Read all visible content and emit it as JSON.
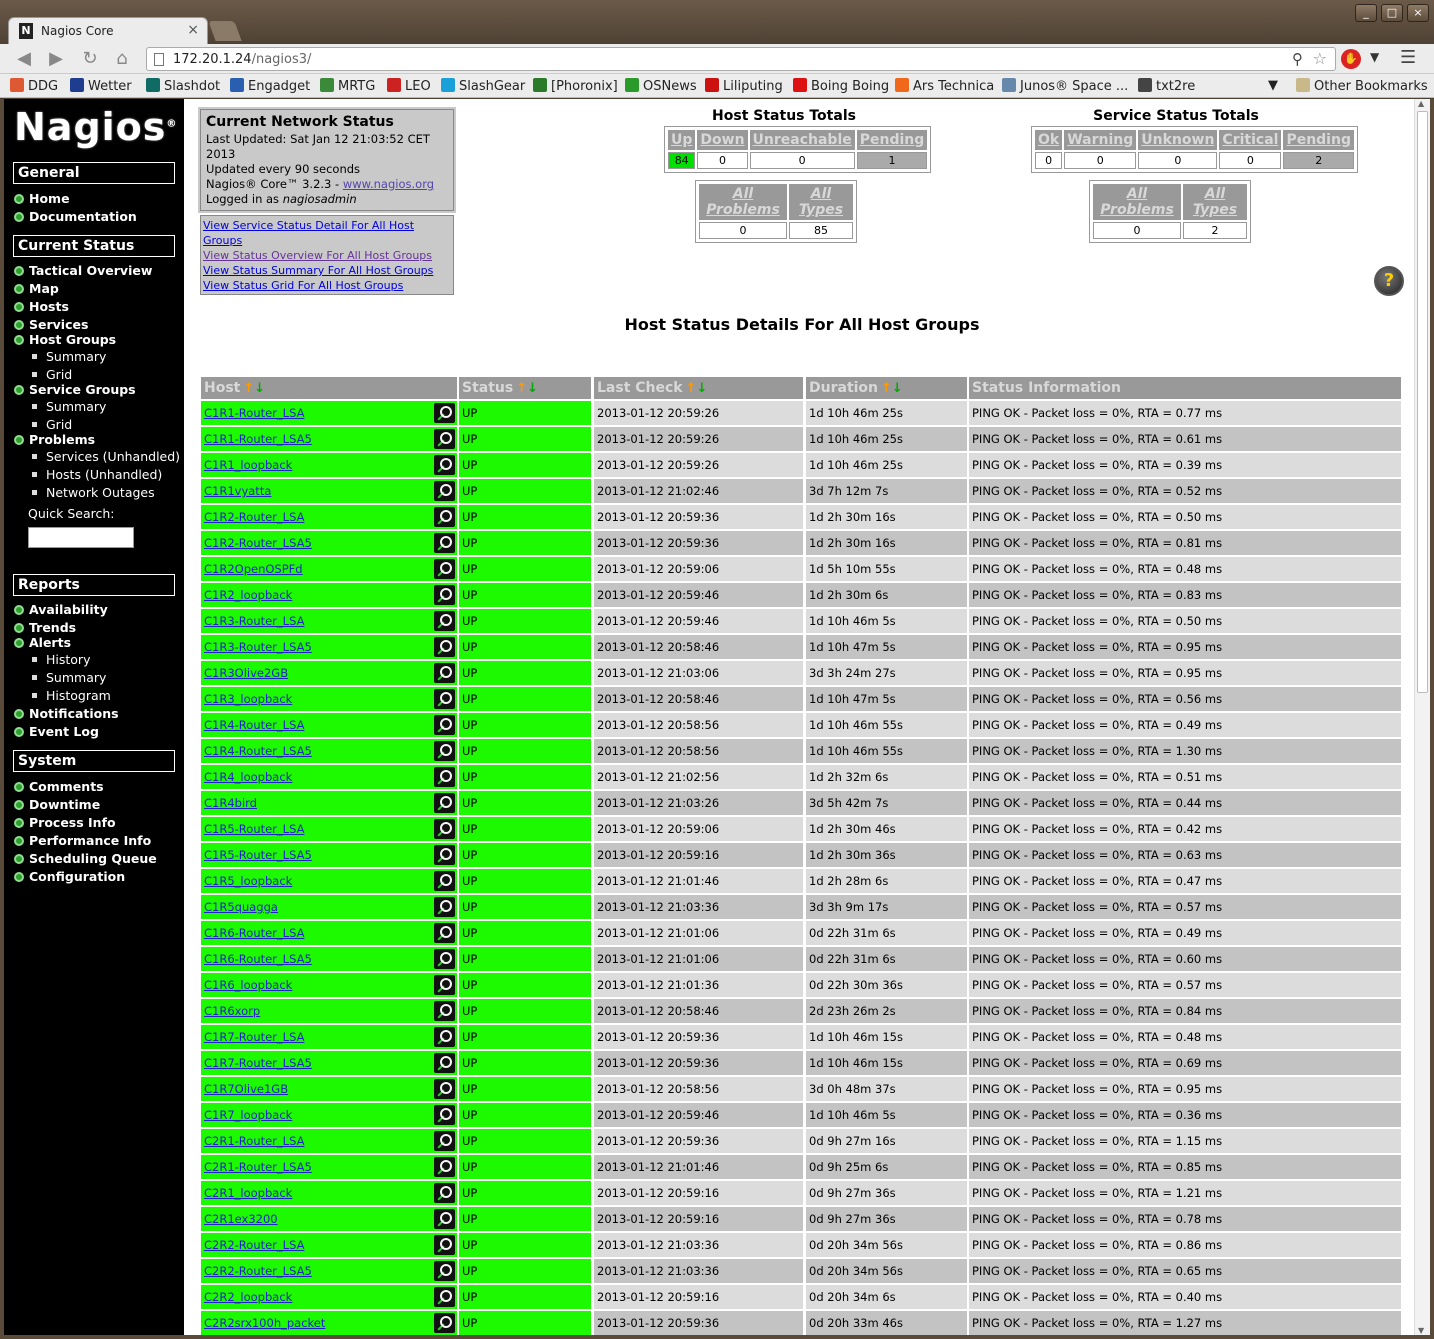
{
  "browser": {
    "tab_title": "Nagios Core",
    "tab_close": "×",
    "favicon_letter": "N",
    "url_host": "172.20.1.24",
    "url_path": "/nagios3/",
    "window_buttons": [
      "_",
      "□",
      "×"
    ]
  },
  "bookmarks": [
    {
      "label": "DDG",
      "color": "#de5833"
    },
    {
      "label": "Wetter",
      "color": "#1e3d8f"
    },
    {
      "label": "Slashdot",
      "color": "#0f6b64"
    },
    {
      "label": "Engadget",
      "color": "#2a5fb0"
    },
    {
      "label": "MRTG",
      "color": "#3a8a3a"
    },
    {
      "label": "LEO",
      "color": "#cc2222"
    },
    {
      "label": "SlashGear",
      "color": "#1aa0d8"
    },
    {
      "label": "[Phoronix]",
      "color": "#2a7a2a"
    },
    {
      "label": "OSNews",
      "color": "#2a9a2a"
    },
    {
      "label": "Liliputing",
      "color": "#cc1111"
    },
    {
      "label": "Boing Boing",
      "color": "#dd1111"
    },
    {
      "label": "Ars Technica",
      "color": "#f0681a"
    },
    {
      "label": "Junos® Space ...",
      "color": "#6688aa"
    },
    {
      "label": "txt2re",
      "color": "#444444"
    }
  ],
  "bookmarks_other": "Other Bookmarks",
  "sidebar": {
    "logo": "Nagios",
    "logo_mark": "®",
    "sections": {
      "general": "General",
      "current_status": "Current Status",
      "reports": "Reports",
      "system": "System"
    },
    "general_links": [
      "Home",
      "Documentation"
    ],
    "current_links": {
      "tactical": "Tactical Overview",
      "map": "Map",
      "hosts": "Hosts",
      "services": "Services",
      "host_groups": "Host Groups",
      "hg_summary": "Summary",
      "hg_grid": "Grid",
      "service_groups": "Service Groups",
      "sg_summary": "Summary",
      "sg_grid": "Grid",
      "problems": "Problems",
      "p_services": "Services (Unhandled)",
      "p_hosts": "Hosts (Unhandled)",
      "p_outages": "Network Outages"
    },
    "quick_search": "Quick Search:",
    "report_links": {
      "availability": "Availability",
      "trends": "Trends",
      "alerts": "Alerts",
      "history": "History",
      "summary": "Summary",
      "histogram": "Histogram",
      "notifications": "Notifications",
      "event_log": "Event Log"
    },
    "system_links": [
      "Comments",
      "Downtime",
      "Process Info",
      "Performance Info",
      "Scheduling Queue",
      "Configuration"
    ]
  },
  "status_box": {
    "title": "Current Network Status",
    "last_updated": "Last Updated: Sat Jan 12 21:03:52 CET 2013",
    "update_interval": "Updated every 90 seconds",
    "version": "Nagios® Core™ 3.2.3 - ",
    "version_link": "www.nagios.org",
    "logged_in_prefix": "Logged in as ",
    "logged_in_user": "nagiosadmin"
  },
  "view_links": [
    "View Service Status Detail For All Host Groups",
    "View Status Overview For All Host Groups",
    "View Status Summary For All Host Groups",
    "View Status Grid For All Host Groups"
  ],
  "host_totals": {
    "title": "Host Status Totals",
    "headers": [
      "Up",
      "Down",
      "Unreachable",
      "Pending"
    ],
    "values": [
      "84",
      "0",
      "0",
      "1"
    ],
    "all_headers": [
      "All Problems",
      "All Types"
    ],
    "all_values": [
      "0",
      "85"
    ]
  },
  "service_totals": {
    "title": "Service Status Totals",
    "headers": [
      "Ok",
      "Warning",
      "Unknown",
      "Critical",
      "Pending"
    ],
    "values": [
      "0",
      "0",
      "0",
      "0",
      "2"
    ],
    "all_headers": [
      "All Problems",
      "All Types"
    ],
    "all_values": [
      "0",
      "2"
    ]
  },
  "help_icon": "?",
  "page_title": "Host Status Details For All Host Groups",
  "table": {
    "headers": {
      "host": "Host",
      "status": "Status",
      "last_check": "Last Check",
      "duration": "Duration",
      "info": "Status Information"
    },
    "sort_up": "↑",
    "sort_down": "↓",
    "rows": [
      {
        "host": "C1R1-Router_LSA",
        "status": "UP",
        "last": "2013-01-12 20:59:26",
        "dur": "1d 10h 46m 25s",
        "info": "PING OK - Packet loss = 0%, RTA = 0.77 ms"
      },
      {
        "host": "C1R1-Router_LSA5",
        "status": "UP",
        "last": "2013-01-12 20:59:26",
        "dur": "1d 10h 46m 25s",
        "info": "PING OK - Packet loss = 0%, RTA = 0.61 ms"
      },
      {
        "host": "C1R1_loopback",
        "status": "UP",
        "last": "2013-01-12 20:59:26",
        "dur": "1d 10h 46m 25s",
        "info": "PING OK - Packet loss = 0%, RTA = 0.39 ms"
      },
      {
        "host": "C1R1vyatta",
        "status": "UP",
        "last": "2013-01-12 21:02:46",
        "dur": "3d 7h 12m 7s",
        "info": "PING OK - Packet loss = 0%, RTA = 0.52 ms"
      },
      {
        "host": "C1R2-Router_LSA",
        "status": "UP",
        "last": "2013-01-12 20:59:36",
        "dur": "1d 2h 30m 16s",
        "info": "PING OK - Packet loss = 0%, RTA = 0.50 ms"
      },
      {
        "host": "C1R2-Router_LSA5",
        "status": "UP",
        "last": "2013-01-12 20:59:36",
        "dur": "1d 2h 30m 16s",
        "info": "PING OK - Packet loss = 0%, RTA = 0.81 ms"
      },
      {
        "host": "C1R2OpenOSPFd",
        "status": "UP",
        "last": "2013-01-12 20:59:06",
        "dur": "1d 5h 10m 55s",
        "info": "PING OK - Packet loss = 0%, RTA = 0.48 ms"
      },
      {
        "host": "C1R2_loopback",
        "status": "UP",
        "last": "2013-01-12 20:59:46",
        "dur": "1d 2h 30m 6s",
        "info": "PING OK - Packet loss = 0%, RTA = 0.83 ms"
      },
      {
        "host": "C1R3-Router_LSA",
        "status": "UP",
        "last": "2013-01-12 20:59:46",
        "dur": "1d 10h 46m 5s",
        "info": "PING OK - Packet loss = 0%, RTA = 0.50 ms"
      },
      {
        "host": "C1R3-Router_LSA5",
        "status": "UP",
        "last": "2013-01-12 20:58:46",
        "dur": "1d 10h 47m 5s",
        "info": "PING OK - Packet loss = 0%, RTA = 0.95 ms"
      },
      {
        "host": "C1R3Olive2GB",
        "status": "UP",
        "last": "2013-01-12 21:03:06",
        "dur": "3d 3h 24m 27s",
        "info": "PING OK - Packet loss = 0%, RTA = 0.95 ms"
      },
      {
        "host": "C1R3_loopback",
        "status": "UP",
        "last": "2013-01-12 20:58:46",
        "dur": "1d 10h 47m 5s",
        "info": "PING OK - Packet loss = 0%, RTA = 0.56 ms"
      },
      {
        "host": "C1R4-Router_LSA",
        "status": "UP",
        "last": "2013-01-12 20:58:56",
        "dur": "1d 10h 46m 55s",
        "info": "PING OK - Packet loss = 0%, RTA = 0.49 ms"
      },
      {
        "host": "C1R4-Router_LSA5",
        "status": "UP",
        "last": "2013-01-12 20:58:56",
        "dur": "1d 10h 46m 55s",
        "info": "PING OK - Packet loss = 0%, RTA = 1.30 ms"
      },
      {
        "host": "C1R4_loopback",
        "status": "UP",
        "last": "2013-01-12 21:02:56",
        "dur": "1d 2h 32m 6s",
        "info": "PING OK - Packet loss = 0%, RTA = 0.51 ms"
      },
      {
        "host": "C1R4bird",
        "status": "UP",
        "last": "2013-01-12 21:03:26",
        "dur": "3d 5h 42m 7s",
        "info": "PING OK - Packet loss = 0%, RTA = 0.44 ms"
      },
      {
        "host": "C1R5-Router_LSA",
        "status": "UP",
        "last": "2013-01-12 20:59:06",
        "dur": "1d 2h 30m 46s",
        "info": "PING OK - Packet loss = 0%, RTA = 0.42 ms"
      },
      {
        "host": "C1R5-Router_LSA5",
        "status": "UP",
        "last": "2013-01-12 20:59:16",
        "dur": "1d 2h 30m 36s",
        "info": "PING OK - Packet loss = 0%, RTA = 0.63 ms"
      },
      {
        "host": "C1R5_loopback",
        "status": "UP",
        "last": "2013-01-12 21:01:46",
        "dur": "1d 2h 28m 6s",
        "info": "PING OK - Packet loss = 0%, RTA = 0.47 ms"
      },
      {
        "host": "C1R5quagga",
        "status": "UP",
        "last": "2013-01-12 21:03:36",
        "dur": "3d 3h 9m 17s",
        "info": "PING OK - Packet loss = 0%, RTA = 0.57 ms"
      },
      {
        "host": "C1R6-Router_LSA",
        "status": "UP",
        "last": "2013-01-12 21:01:06",
        "dur": "0d 22h 31m 6s",
        "info": "PING OK - Packet loss = 0%, RTA = 0.49 ms"
      },
      {
        "host": "C1R6-Router_LSA5",
        "status": "UP",
        "last": "2013-01-12 21:01:06",
        "dur": "0d 22h 31m 6s",
        "info": "PING OK - Packet loss = 0%, RTA = 0.60 ms"
      },
      {
        "host": "C1R6_loopback",
        "status": "UP",
        "last": "2013-01-12 21:01:36",
        "dur": "0d 22h 30m 36s",
        "info": "PING OK - Packet loss = 0%, RTA = 0.57 ms"
      },
      {
        "host": "C1R6xorp",
        "status": "UP",
        "last": "2013-01-12 20:58:46",
        "dur": "2d 23h 26m 2s",
        "info": "PING OK - Packet loss = 0%, RTA = 0.84 ms"
      },
      {
        "host": "C1R7-Router_LSA",
        "status": "UP",
        "last": "2013-01-12 20:59:36",
        "dur": "1d 10h 46m 15s",
        "info": "PING OK - Packet loss = 0%, RTA = 0.48 ms"
      },
      {
        "host": "C1R7-Router_LSA5",
        "status": "UP",
        "last": "2013-01-12 20:59:36",
        "dur": "1d 10h 46m 15s",
        "info": "PING OK - Packet loss = 0%, RTA = 0.69 ms"
      },
      {
        "host": "C1R7Olive1GB",
        "status": "UP",
        "last": "2013-01-12 20:58:56",
        "dur": "3d 0h 48m 37s",
        "info": "PING OK - Packet loss = 0%, RTA = 0.95 ms"
      },
      {
        "host": "C1R7_loopback",
        "status": "UP",
        "last": "2013-01-12 20:59:46",
        "dur": "1d 10h 46m 5s",
        "info": "PING OK - Packet loss = 0%, RTA = 0.36 ms"
      },
      {
        "host": "C2R1-Router_LSA",
        "status": "UP",
        "last": "2013-01-12 20:59:36",
        "dur": "0d 9h 27m 16s",
        "info": "PING OK - Packet loss = 0%, RTA = 1.15 ms"
      },
      {
        "host": "C2R1-Router_LSA5",
        "status": "UP",
        "last": "2013-01-12 21:01:46",
        "dur": "0d 9h 25m 6s",
        "info": "PING OK - Packet loss = 0%, RTA = 0.85 ms"
      },
      {
        "host": "C2R1_loopback",
        "status": "UP",
        "last": "2013-01-12 20:59:16",
        "dur": "0d 9h 27m 36s",
        "info": "PING OK - Packet loss = 0%, RTA = 1.21 ms"
      },
      {
        "host": "C2R1ex3200",
        "status": "UP",
        "last": "2013-01-12 20:59:16",
        "dur": "0d 9h 27m 36s",
        "info": "PING OK - Packet loss = 0%, RTA = 0.78 ms"
      },
      {
        "host": "C2R2-Router_LSA",
        "status": "UP",
        "last": "2013-01-12 21:03:36",
        "dur": "0d 20h 34m 56s",
        "info": "PING OK - Packet loss = 0%, RTA = 0.86 ms"
      },
      {
        "host": "C2R2-Router_LSA5",
        "status": "UP",
        "last": "2013-01-12 21:03:36",
        "dur": "0d 20h 34m 56s",
        "info": "PING OK - Packet loss = 0%, RTA = 0.65 ms"
      },
      {
        "host": "C2R2_loopback",
        "status": "UP",
        "last": "2013-01-12 20:59:16",
        "dur": "0d 20h 34m 6s",
        "info": "PING OK - Packet loss = 0%, RTA = 0.40 ms"
      },
      {
        "host": "C2R2srx100h_packet",
        "status": "UP",
        "last": "2013-01-12 20:59:36",
        "dur": "0d 20h 33m 46s",
        "info": "PING OK - Packet loss = 0%, RTA = 1.27 ms"
      }
    ]
  }
}
